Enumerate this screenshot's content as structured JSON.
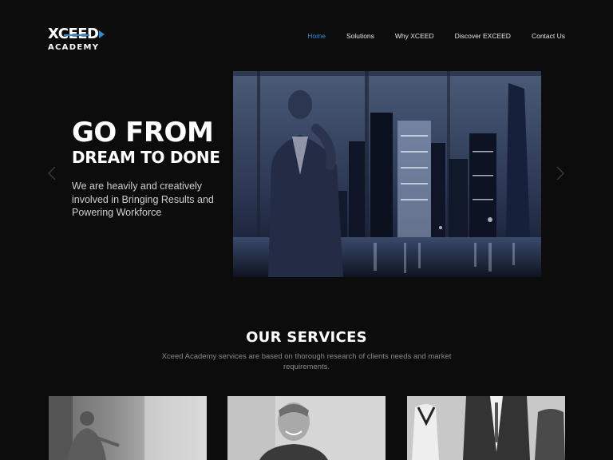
{
  "logo": {
    "line1": "XCEED",
    "line2": "ACADEMY"
  },
  "nav": [
    {
      "label": "Home",
      "active": true
    },
    {
      "label": "Solutions",
      "active": false
    },
    {
      "label": "Why XCEED",
      "active": false
    },
    {
      "label": "Discover EXCEED",
      "active": false
    },
    {
      "label": "Contact Us",
      "active": false
    }
  ],
  "hero": {
    "headline": "GO FROM",
    "subheadline": "DREAM TO DONE",
    "description": "We are heavily and creatively involved in Bringing Results and Powering Workforce"
  },
  "services": {
    "title": "OUR SERVICES",
    "description": "Xceed Academy services are based on thorough research of clients needs and market requirements."
  },
  "colors": {
    "accent": "#2f8fde",
    "background": "#0c0c0d"
  },
  "icons": {
    "prev": "chevron-left-icon",
    "next": "chevron-right-icon"
  }
}
